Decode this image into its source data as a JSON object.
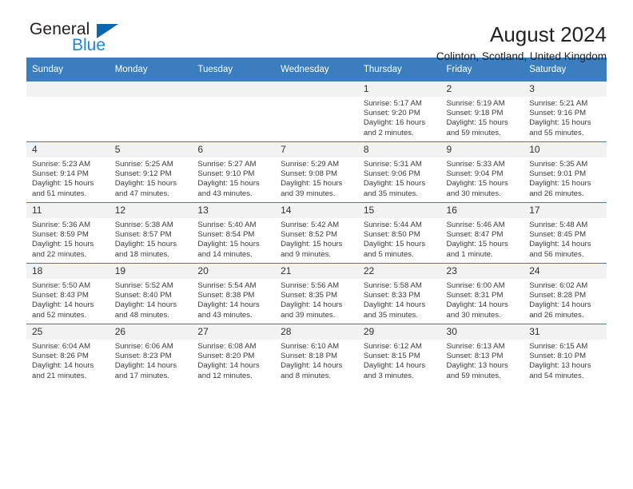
{
  "brand": {
    "name_part1": "General",
    "name_part2": "Blue",
    "triangle_icon": "triangle-icon",
    "accent_color": "#1f86d0",
    "logo_blue": "#0a66b0"
  },
  "header": {
    "title": "August 2024",
    "subtitle": "Colinton, Scotland, United Kingdom"
  },
  "theme": {
    "header_row_bg": "#3a7ebf",
    "daynum_bg": "#f2f2f2",
    "grid_line": "#3a7ebf"
  },
  "columns": [
    "Sunday",
    "Monday",
    "Tuesday",
    "Wednesday",
    "Thursday",
    "Friday",
    "Saturday"
  ],
  "labels": {
    "sunrise": "Sunrise:",
    "sunset": "Sunset:",
    "daylight": "Daylight:"
  },
  "weeks": [
    [
      {
        "day": "",
        "empty": true
      },
      {
        "day": "",
        "empty": true
      },
      {
        "day": "",
        "empty": true
      },
      {
        "day": "",
        "empty": true
      },
      {
        "day": "1",
        "sunrise": "Sunrise: 5:17 AM",
        "sunset": "Sunset: 9:20 PM",
        "daylight_line1": "Daylight: 16 hours",
        "daylight_line2": "and 2 minutes."
      },
      {
        "day": "2",
        "sunrise": "Sunrise: 5:19 AM",
        "sunset": "Sunset: 9:18 PM",
        "daylight_line1": "Daylight: 15 hours",
        "daylight_line2": "and 59 minutes."
      },
      {
        "day": "3",
        "sunrise": "Sunrise: 5:21 AM",
        "sunset": "Sunset: 9:16 PM",
        "daylight_line1": "Daylight: 15 hours",
        "daylight_line2": "and 55 minutes."
      }
    ],
    [
      {
        "day": "4",
        "sunrise": "Sunrise: 5:23 AM",
        "sunset": "Sunset: 9:14 PM",
        "daylight_line1": "Daylight: 15 hours",
        "daylight_line2": "and 51 minutes."
      },
      {
        "day": "5",
        "sunrise": "Sunrise: 5:25 AM",
        "sunset": "Sunset: 9:12 PM",
        "daylight_line1": "Daylight: 15 hours",
        "daylight_line2": "and 47 minutes."
      },
      {
        "day": "6",
        "sunrise": "Sunrise: 5:27 AM",
        "sunset": "Sunset: 9:10 PM",
        "daylight_line1": "Daylight: 15 hours",
        "daylight_line2": "and 43 minutes."
      },
      {
        "day": "7",
        "sunrise": "Sunrise: 5:29 AM",
        "sunset": "Sunset: 9:08 PM",
        "daylight_line1": "Daylight: 15 hours",
        "daylight_line2": "and 39 minutes."
      },
      {
        "day": "8",
        "sunrise": "Sunrise: 5:31 AM",
        "sunset": "Sunset: 9:06 PM",
        "daylight_line1": "Daylight: 15 hours",
        "daylight_line2": "and 35 minutes."
      },
      {
        "day": "9",
        "sunrise": "Sunrise: 5:33 AM",
        "sunset": "Sunset: 9:04 PM",
        "daylight_line1": "Daylight: 15 hours",
        "daylight_line2": "and 30 minutes."
      },
      {
        "day": "10",
        "sunrise": "Sunrise: 5:35 AM",
        "sunset": "Sunset: 9:01 PM",
        "daylight_line1": "Daylight: 15 hours",
        "daylight_line2": "and 26 minutes."
      }
    ],
    [
      {
        "day": "11",
        "sunrise": "Sunrise: 5:36 AM",
        "sunset": "Sunset: 8:59 PM",
        "daylight_line1": "Daylight: 15 hours",
        "daylight_line2": "and 22 minutes."
      },
      {
        "day": "12",
        "sunrise": "Sunrise: 5:38 AM",
        "sunset": "Sunset: 8:57 PM",
        "daylight_line1": "Daylight: 15 hours",
        "daylight_line2": "and 18 minutes."
      },
      {
        "day": "13",
        "sunrise": "Sunrise: 5:40 AM",
        "sunset": "Sunset: 8:54 PM",
        "daylight_line1": "Daylight: 15 hours",
        "daylight_line2": "and 14 minutes."
      },
      {
        "day": "14",
        "sunrise": "Sunrise: 5:42 AM",
        "sunset": "Sunset: 8:52 PM",
        "daylight_line1": "Daylight: 15 hours",
        "daylight_line2": "and 9 minutes."
      },
      {
        "day": "15",
        "sunrise": "Sunrise: 5:44 AM",
        "sunset": "Sunset: 8:50 PM",
        "daylight_line1": "Daylight: 15 hours",
        "daylight_line2": "and 5 minutes."
      },
      {
        "day": "16",
        "sunrise": "Sunrise: 5:46 AM",
        "sunset": "Sunset: 8:47 PM",
        "daylight_line1": "Daylight: 15 hours",
        "daylight_line2": "and 1 minute."
      },
      {
        "day": "17",
        "sunrise": "Sunrise: 5:48 AM",
        "sunset": "Sunset: 8:45 PM",
        "daylight_line1": "Daylight: 14 hours",
        "daylight_line2": "and 56 minutes."
      }
    ],
    [
      {
        "day": "18",
        "sunrise": "Sunrise: 5:50 AM",
        "sunset": "Sunset: 8:43 PM",
        "daylight_line1": "Daylight: 14 hours",
        "daylight_line2": "and 52 minutes."
      },
      {
        "day": "19",
        "sunrise": "Sunrise: 5:52 AM",
        "sunset": "Sunset: 8:40 PM",
        "daylight_line1": "Daylight: 14 hours",
        "daylight_line2": "and 48 minutes."
      },
      {
        "day": "20",
        "sunrise": "Sunrise: 5:54 AM",
        "sunset": "Sunset: 8:38 PM",
        "daylight_line1": "Daylight: 14 hours",
        "daylight_line2": "and 43 minutes."
      },
      {
        "day": "21",
        "sunrise": "Sunrise: 5:56 AM",
        "sunset": "Sunset: 8:35 PM",
        "daylight_line1": "Daylight: 14 hours",
        "daylight_line2": "and 39 minutes."
      },
      {
        "day": "22",
        "sunrise": "Sunrise: 5:58 AM",
        "sunset": "Sunset: 8:33 PM",
        "daylight_line1": "Daylight: 14 hours",
        "daylight_line2": "and 35 minutes."
      },
      {
        "day": "23",
        "sunrise": "Sunrise: 6:00 AM",
        "sunset": "Sunset: 8:31 PM",
        "daylight_line1": "Daylight: 14 hours",
        "daylight_line2": "and 30 minutes."
      },
      {
        "day": "24",
        "sunrise": "Sunrise: 6:02 AM",
        "sunset": "Sunset: 8:28 PM",
        "daylight_line1": "Daylight: 14 hours",
        "daylight_line2": "and 26 minutes."
      }
    ],
    [
      {
        "day": "25",
        "sunrise": "Sunrise: 6:04 AM",
        "sunset": "Sunset: 8:26 PM",
        "daylight_line1": "Daylight: 14 hours",
        "daylight_line2": "and 21 minutes."
      },
      {
        "day": "26",
        "sunrise": "Sunrise: 6:06 AM",
        "sunset": "Sunset: 8:23 PM",
        "daylight_line1": "Daylight: 14 hours",
        "daylight_line2": "and 17 minutes."
      },
      {
        "day": "27",
        "sunrise": "Sunrise: 6:08 AM",
        "sunset": "Sunset: 8:20 PM",
        "daylight_line1": "Daylight: 14 hours",
        "daylight_line2": "and 12 minutes."
      },
      {
        "day": "28",
        "sunrise": "Sunrise: 6:10 AM",
        "sunset": "Sunset: 8:18 PM",
        "daylight_line1": "Daylight: 14 hours",
        "daylight_line2": "and 8 minutes."
      },
      {
        "day": "29",
        "sunrise": "Sunrise: 6:12 AM",
        "sunset": "Sunset: 8:15 PM",
        "daylight_line1": "Daylight: 14 hours",
        "daylight_line2": "and 3 minutes."
      },
      {
        "day": "30",
        "sunrise": "Sunrise: 6:13 AM",
        "sunset": "Sunset: 8:13 PM",
        "daylight_line1": "Daylight: 13 hours",
        "daylight_line2": "and 59 minutes."
      },
      {
        "day": "31",
        "sunrise": "Sunrise: 6:15 AM",
        "sunset": "Sunset: 8:10 PM",
        "daylight_line1": "Daylight: 13 hours",
        "daylight_line2": "and 54 minutes."
      }
    ]
  ]
}
